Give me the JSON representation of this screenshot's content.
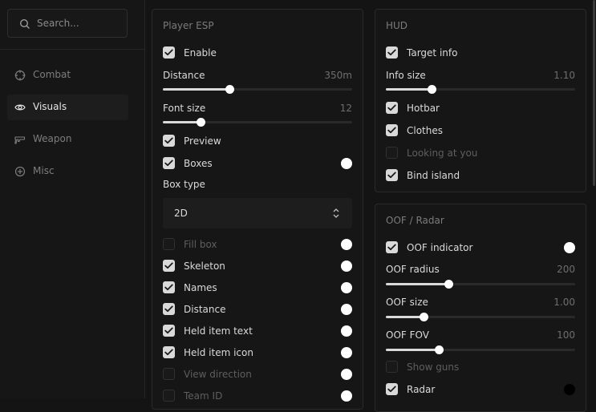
{
  "search": {
    "placeholder": "Search..."
  },
  "nav": [
    {
      "label": "Combat",
      "icon": "crosshair-icon",
      "active": false
    },
    {
      "label": "Visuals",
      "icon": "eye-icon",
      "active": true
    },
    {
      "label": "Weapon",
      "icon": "gun-icon",
      "active": false
    },
    {
      "label": "Misc",
      "icon": "plus-circle-icon",
      "active": false
    }
  ],
  "player_esp": {
    "title": "Player ESP",
    "enable": {
      "label": "Enable",
      "checked": true
    },
    "distance": {
      "label": "Distance",
      "value": "350m",
      "fraction": 0.35
    },
    "font_size": {
      "label": "Font size",
      "value": "12",
      "fraction": 0.2
    },
    "preview": {
      "label": "Preview",
      "checked": true
    },
    "boxes": {
      "label": "Boxes",
      "checked": true,
      "color": "#ffffff"
    },
    "box_type": {
      "label": "Box type",
      "value": "2D"
    },
    "fill_box": {
      "label": "Fill box",
      "checked": false,
      "color": "#ffffff"
    },
    "skeleton": {
      "label": "Skeleton",
      "checked": true,
      "color": "#ffffff"
    },
    "names": {
      "label": "Names",
      "checked": true,
      "color": "#ffffff"
    },
    "distance_toggle": {
      "label": "Distance",
      "checked": true,
      "color": "#ffffff"
    },
    "held_item_text": {
      "label": "Held item text",
      "checked": true,
      "color": "#ffffff"
    },
    "held_item_icon": {
      "label": "Held item icon",
      "checked": true,
      "color": "#ffffff"
    },
    "view_direction": {
      "label": "View direction",
      "checked": false,
      "color": "#ffffff"
    },
    "team_id": {
      "label": "Team ID",
      "checked": false,
      "color": "#ffffff"
    }
  },
  "hud": {
    "title": "HUD",
    "target_info": {
      "label": "Target info",
      "checked": true
    },
    "info_size": {
      "label": "Info size",
      "value": "1.10",
      "fraction": 0.24
    },
    "hotbar": {
      "label": "Hotbar",
      "checked": true
    },
    "clothes": {
      "label": "Clothes",
      "checked": true
    },
    "looking_at_you": {
      "label": "Looking at you",
      "checked": false
    },
    "bind_island": {
      "label": "Bind island",
      "checked": true
    }
  },
  "oof_radar": {
    "title": "OOF / Radar",
    "oof_indicator": {
      "label": "OOF indicator",
      "checked": true,
      "color": "#ffffff"
    },
    "oof_radius": {
      "label": "OOF radius",
      "value": "200",
      "fraction": 0.33
    },
    "oof_size": {
      "label": "OOF size",
      "value": "1.00",
      "fraction": 0.2
    },
    "oof_fov": {
      "label": "OOF FOV",
      "value": "100",
      "fraction": 0.28
    },
    "show_guns": {
      "label": "Show guns",
      "checked": false
    },
    "radar": {
      "label": "Radar",
      "checked": true,
      "color": "#000000"
    }
  }
}
